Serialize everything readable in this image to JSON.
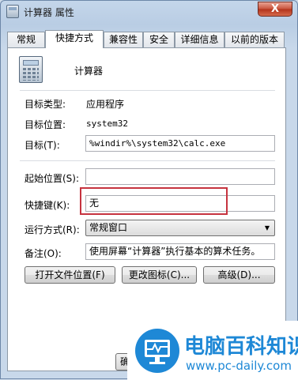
{
  "window": {
    "title": "计算器 属性",
    "close_label": "X"
  },
  "tabs": [
    {
      "label": "常规"
    },
    {
      "label": "快捷方式"
    },
    {
      "label": "兼容性"
    },
    {
      "label": "安全"
    },
    {
      "label": "详细信息"
    },
    {
      "label": "以前的版本"
    }
  ],
  "shortcut": {
    "name": "计算器",
    "target_type_label": "目标类型:",
    "target_type_value": "应用程序",
    "target_location_label": "目标位置:",
    "target_location_value": "system32",
    "target_label": "目标(T):",
    "target_value": "%windir%\\system32\\calc.exe",
    "start_in_label": "起始位置(S):",
    "start_in_value": "",
    "hotkey_label": "快捷键(K):",
    "hotkey_value": "无",
    "run_label": "运行方式(R):",
    "run_value": "常规窗口",
    "comment_label": "备注(O):",
    "comment_value": "使用屏幕“计算器”执行基本的算术任务。"
  },
  "buttons": {
    "open_location": "打开文件位置(F)",
    "change_icon": "更改图标(C)...",
    "advanced": "高级(D)...",
    "ok_partial": "确"
  },
  "watermark": {
    "title": "电脑百科知识",
    "url": "www.pc-daily.com"
  },
  "colors": {
    "highlight": "#c6333f",
    "watermark_blue": "#1e88d6"
  }
}
